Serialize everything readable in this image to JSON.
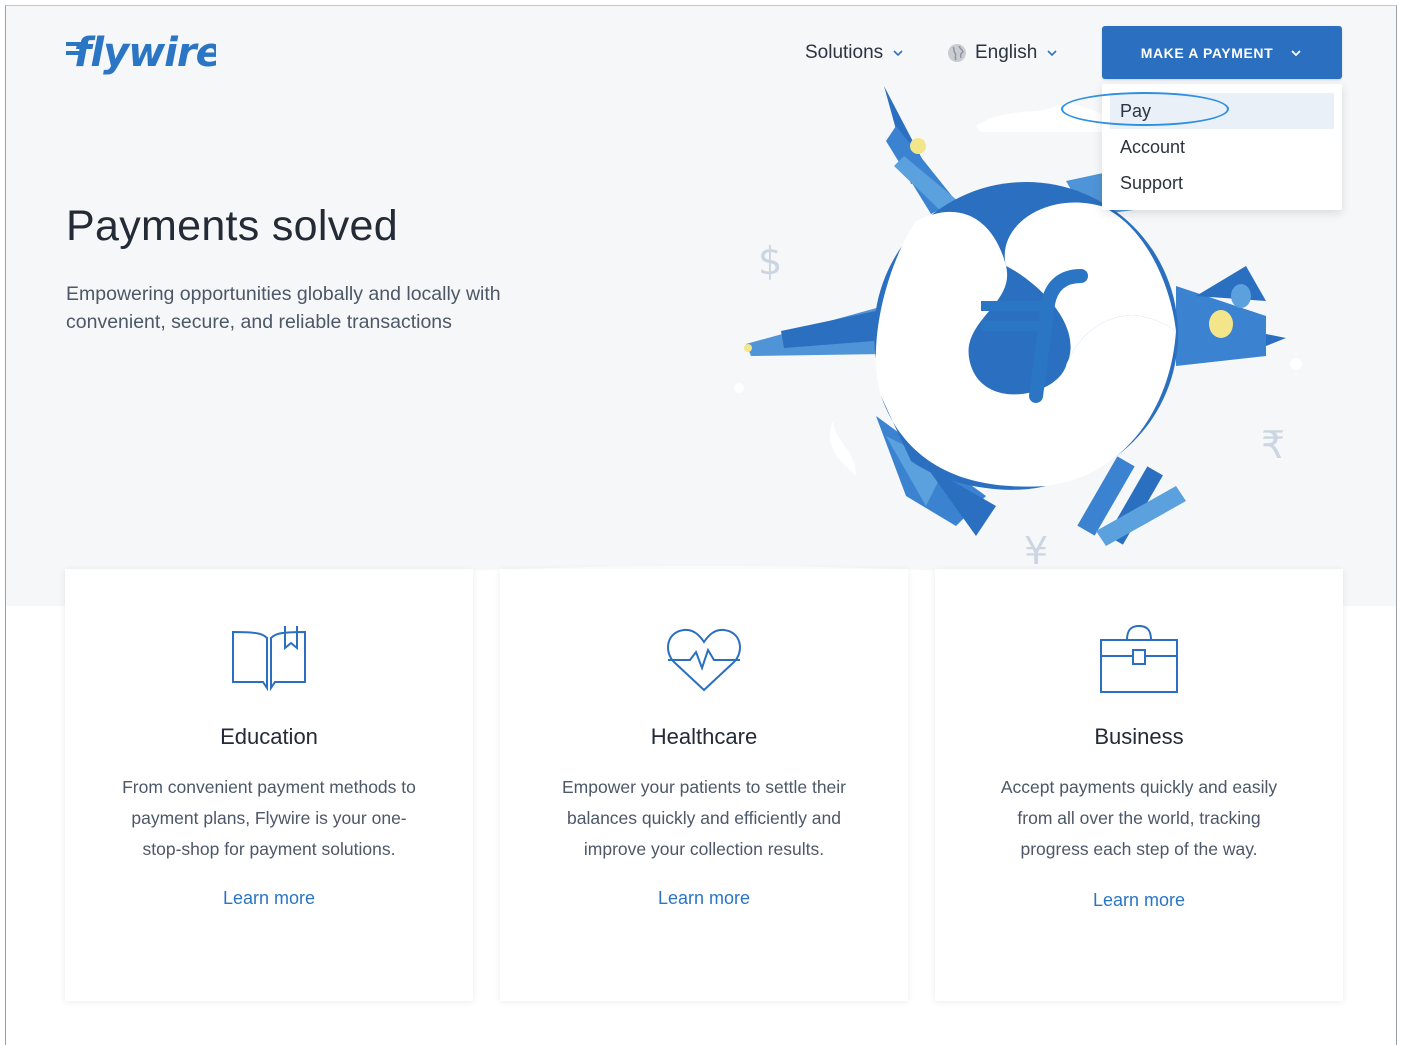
{
  "brand": {
    "logo_text": "flywire",
    "accent": "#2a75c4",
    "button_color": "#2a6fc0"
  },
  "header": {
    "nav": [
      {
        "label": "Solutions",
        "icon": "chevron-down-icon"
      },
      {
        "label": "English",
        "icon": "globe-icon"
      }
    ],
    "cta_label": "MAKE A PAYMENT",
    "dropdown": [
      "Pay",
      "Account",
      "Support"
    ],
    "dropdown_selected": "Pay"
  },
  "hero": {
    "title": "Payments solved",
    "subtitle": "Empowering opportunities globally and locally with convenient, secure, and reliable transactions",
    "currency_symbols": [
      "$",
      "₹",
      "¥"
    ]
  },
  "cards": [
    {
      "icon": "open-book-icon",
      "title": "Education",
      "text": "From convenient payment methods to payment plans, Flywire is your one-stop-shop for payment solutions.",
      "link": "Learn more"
    },
    {
      "icon": "heart-pulse-icon",
      "title": "Healthcare",
      "text": "Empower your patients to settle their balances quickly and efficiently and improve your collection results.",
      "link": "Learn more"
    },
    {
      "icon": "briefcase-icon",
      "title": "Business",
      "text": "Accept payments quickly and easily from all over the world, tracking progress each step of the way.",
      "link": "Learn more"
    }
  ]
}
